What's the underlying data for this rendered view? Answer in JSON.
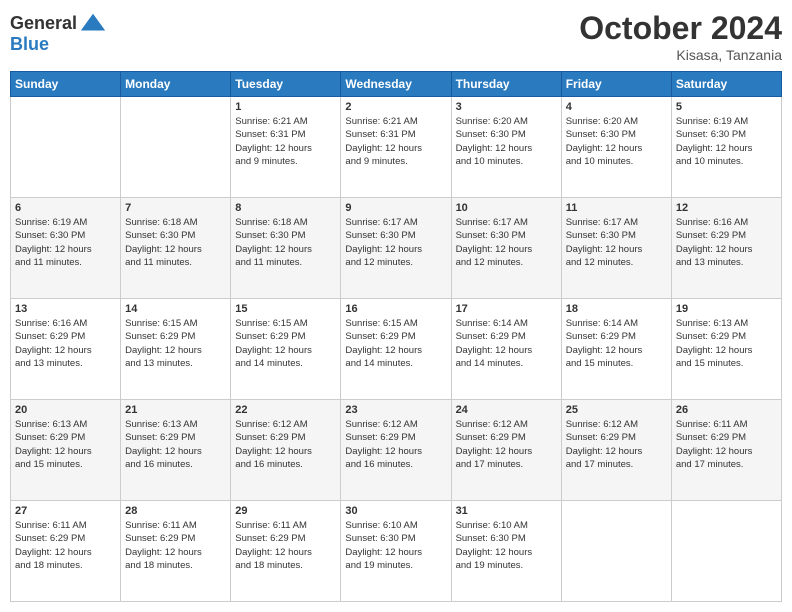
{
  "header": {
    "logo_line1": "General",
    "logo_line2": "Blue",
    "month_title": "October 2024",
    "subtitle": "Kisasa, Tanzania"
  },
  "weekdays": [
    "Sunday",
    "Monday",
    "Tuesday",
    "Wednesday",
    "Thursday",
    "Friday",
    "Saturday"
  ],
  "weeks": [
    [
      {
        "day": "",
        "info": ""
      },
      {
        "day": "",
        "info": ""
      },
      {
        "day": "1",
        "info": "Sunrise: 6:21 AM\nSunset: 6:31 PM\nDaylight: 12 hours\nand 9 minutes."
      },
      {
        "day": "2",
        "info": "Sunrise: 6:21 AM\nSunset: 6:31 PM\nDaylight: 12 hours\nand 9 minutes."
      },
      {
        "day": "3",
        "info": "Sunrise: 6:20 AM\nSunset: 6:30 PM\nDaylight: 12 hours\nand 10 minutes."
      },
      {
        "day": "4",
        "info": "Sunrise: 6:20 AM\nSunset: 6:30 PM\nDaylight: 12 hours\nand 10 minutes."
      },
      {
        "day": "5",
        "info": "Sunrise: 6:19 AM\nSunset: 6:30 PM\nDaylight: 12 hours\nand 10 minutes."
      }
    ],
    [
      {
        "day": "6",
        "info": "Sunrise: 6:19 AM\nSunset: 6:30 PM\nDaylight: 12 hours\nand 11 minutes."
      },
      {
        "day": "7",
        "info": "Sunrise: 6:18 AM\nSunset: 6:30 PM\nDaylight: 12 hours\nand 11 minutes."
      },
      {
        "day": "8",
        "info": "Sunrise: 6:18 AM\nSunset: 6:30 PM\nDaylight: 12 hours\nand 11 minutes."
      },
      {
        "day": "9",
        "info": "Sunrise: 6:17 AM\nSunset: 6:30 PM\nDaylight: 12 hours\nand 12 minutes."
      },
      {
        "day": "10",
        "info": "Sunrise: 6:17 AM\nSunset: 6:30 PM\nDaylight: 12 hours\nand 12 minutes."
      },
      {
        "day": "11",
        "info": "Sunrise: 6:17 AM\nSunset: 6:30 PM\nDaylight: 12 hours\nand 12 minutes."
      },
      {
        "day": "12",
        "info": "Sunrise: 6:16 AM\nSunset: 6:29 PM\nDaylight: 12 hours\nand 13 minutes."
      }
    ],
    [
      {
        "day": "13",
        "info": "Sunrise: 6:16 AM\nSunset: 6:29 PM\nDaylight: 12 hours\nand 13 minutes."
      },
      {
        "day": "14",
        "info": "Sunrise: 6:15 AM\nSunset: 6:29 PM\nDaylight: 12 hours\nand 13 minutes."
      },
      {
        "day": "15",
        "info": "Sunrise: 6:15 AM\nSunset: 6:29 PM\nDaylight: 12 hours\nand 14 minutes."
      },
      {
        "day": "16",
        "info": "Sunrise: 6:15 AM\nSunset: 6:29 PM\nDaylight: 12 hours\nand 14 minutes."
      },
      {
        "day": "17",
        "info": "Sunrise: 6:14 AM\nSunset: 6:29 PM\nDaylight: 12 hours\nand 14 minutes."
      },
      {
        "day": "18",
        "info": "Sunrise: 6:14 AM\nSunset: 6:29 PM\nDaylight: 12 hours\nand 15 minutes."
      },
      {
        "day": "19",
        "info": "Sunrise: 6:13 AM\nSunset: 6:29 PM\nDaylight: 12 hours\nand 15 minutes."
      }
    ],
    [
      {
        "day": "20",
        "info": "Sunrise: 6:13 AM\nSunset: 6:29 PM\nDaylight: 12 hours\nand 15 minutes."
      },
      {
        "day": "21",
        "info": "Sunrise: 6:13 AM\nSunset: 6:29 PM\nDaylight: 12 hours\nand 16 minutes."
      },
      {
        "day": "22",
        "info": "Sunrise: 6:12 AM\nSunset: 6:29 PM\nDaylight: 12 hours\nand 16 minutes."
      },
      {
        "day": "23",
        "info": "Sunrise: 6:12 AM\nSunset: 6:29 PM\nDaylight: 12 hours\nand 16 minutes."
      },
      {
        "day": "24",
        "info": "Sunrise: 6:12 AM\nSunset: 6:29 PM\nDaylight: 12 hours\nand 17 minutes."
      },
      {
        "day": "25",
        "info": "Sunrise: 6:12 AM\nSunset: 6:29 PM\nDaylight: 12 hours\nand 17 minutes."
      },
      {
        "day": "26",
        "info": "Sunrise: 6:11 AM\nSunset: 6:29 PM\nDaylight: 12 hours\nand 17 minutes."
      }
    ],
    [
      {
        "day": "27",
        "info": "Sunrise: 6:11 AM\nSunset: 6:29 PM\nDaylight: 12 hours\nand 18 minutes."
      },
      {
        "day": "28",
        "info": "Sunrise: 6:11 AM\nSunset: 6:29 PM\nDaylight: 12 hours\nand 18 minutes."
      },
      {
        "day": "29",
        "info": "Sunrise: 6:11 AM\nSunset: 6:29 PM\nDaylight: 12 hours\nand 18 minutes."
      },
      {
        "day": "30",
        "info": "Sunrise: 6:10 AM\nSunset: 6:30 PM\nDaylight: 12 hours\nand 19 minutes."
      },
      {
        "day": "31",
        "info": "Sunrise: 6:10 AM\nSunset: 6:30 PM\nDaylight: 12 hours\nand 19 minutes."
      },
      {
        "day": "",
        "info": ""
      },
      {
        "day": "",
        "info": ""
      }
    ]
  ]
}
